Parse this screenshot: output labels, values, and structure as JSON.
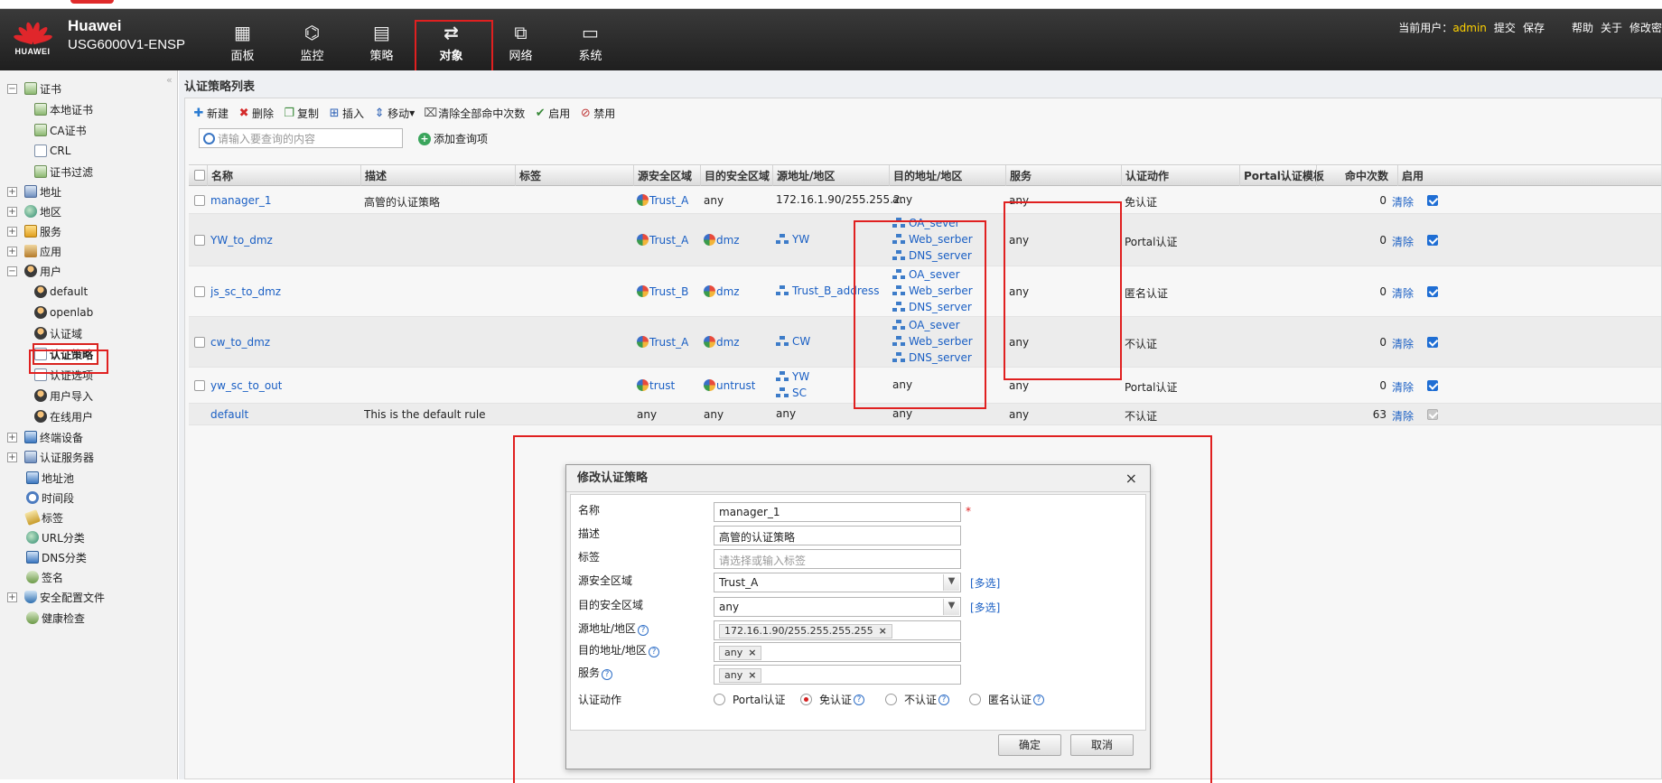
{
  "header": {
    "brand_logo_text": "HUAWEI",
    "brand_name": "Huawei",
    "model": "USG6000V1-ENSP",
    "nav": [
      {
        "label": "面板",
        "icon": "dashboard-icon"
      },
      {
        "label": "监控",
        "icon": "monitor-icon"
      },
      {
        "label": "策略",
        "icon": "policy-icon"
      },
      {
        "label": "对象",
        "icon": "object-icon"
      },
      {
        "label": "网络",
        "icon": "network-icon"
      },
      {
        "label": "系统",
        "icon": "system-icon"
      }
    ],
    "active_nav": "对象",
    "user_label": "当前用户：",
    "username": "admin",
    "menu": [
      "提交",
      "保存",
      "帮助",
      "关于",
      "修改密"
    ]
  },
  "sidebar": {
    "items": [
      {
        "label": "证书",
        "expander": "−",
        "icon": "certificate-icon"
      },
      {
        "label": "本地证书",
        "icon": "local-certificate-icon"
      },
      {
        "label": "CA证书",
        "icon": "ca-certificate-icon"
      },
      {
        "label": "CRL",
        "icon": "crl-icon"
      },
      {
        "label": "证书过滤",
        "icon": "certificate-filter-icon"
      },
      {
        "label": "地址",
        "expander": "+",
        "icon": "address-icon"
      },
      {
        "label": "地区",
        "expander": "+",
        "icon": "region-icon"
      },
      {
        "label": "服务",
        "expander": "+",
        "icon": "service-icon"
      },
      {
        "label": "应用",
        "expander": "+",
        "icon": "application-icon"
      },
      {
        "label": "用户",
        "expander": "−",
        "icon": "user-icon"
      },
      {
        "label": "default",
        "icon": "user-group-icon"
      },
      {
        "label": "openlab",
        "icon": "user-group-icon"
      },
      {
        "label": "认证域",
        "icon": "auth-domain-icon"
      },
      {
        "label": "认证策略",
        "icon": "auth-policy-icon",
        "selected": true
      },
      {
        "label": "认证选项",
        "icon": "auth-options-icon"
      },
      {
        "label": "用户导入",
        "icon": "user-import-icon"
      },
      {
        "label": "在线用户",
        "icon": "online-user-icon"
      },
      {
        "label": "终端设备",
        "expander": "+",
        "icon": "terminal-device-icon"
      },
      {
        "label": "认证服务器",
        "expander": "+",
        "icon": "auth-server-icon"
      },
      {
        "label": "地址池",
        "icon": "address-pool-icon"
      },
      {
        "label": "时间段",
        "icon": "time-range-icon"
      },
      {
        "label": "标签",
        "icon": "tag-icon"
      },
      {
        "label": "URL分类",
        "icon": "url-category-icon"
      },
      {
        "label": "DNS分类",
        "icon": "dns-category-icon"
      },
      {
        "label": "签名",
        "icon": "signature-icon"
      },
      {
        "label": "安全配置文件",
        "expander": "+",
        "icon": "security-profile-icon"
      },
      {
        "label": "健康检查",
        "icon": "health-check-icon"
      }
    ]
  },
  "panel": {
    "title": "认证策略列表",
    "toolbar": [
      {
        "label": "新建",
        "icon": "add-icon"
      },
      {
        "label": "删除",
        "icon": "delete-icon"
      },
      {
        "label": "复制",
        "icon": "copy-icon"
      },
      {
        "label": "插入",
        "icon": "insert-icon"
      },
      {
        "label": "移动",
        "icon": "move-icon",
        "dropdown": true
      },
      {
        "label": "清除全部命中次数",
        "icon": "clear-hits-icon"
      },
      {
        "label": "启用",
        "icon": "enable-icon"
      },
      {
        "label": "禁用",
        "icon": "disable-icon"
      }
    ],
    "search_placeholder": "请输入要查询的内容",
    "add_query_label": "添加查询项"
  },
  "table": {
    "columns": [
      "名称",
      "描述",
      "标签",
      "源安全区域",
      "目的安全区域",
      "源地址/地区",
      "目的地址/地区",
      "服务",
      "认证动作",
      "Portal认证模板",
      "命中次数",
      "启用"
    ],
    "clear_label": "清除",
    "rows": [
      {
        "name": "manager_1",
        "desc": "高管的认证策略",
        "tag": "",
        "src_zone": "Trust_A",
        "dst_zone": "any",
        "src_addr": [
          "172.16.1.90/255.255.2..."
        ],
        "dst_addr": [
          "any"
        ],
        "service": "any",
        "action": "免认证",
        "portal": "",
        "hits": "0",
        "enabled": true
      },
      {
        "name": "YW_to_dmz",
        "desc": "",
        "tag": "",
        "src_zone": "Trust_A",
        "dst_zone": "dmz",
        "src_addr": [
          "YW"
        ],
        "dst_addr": [
          "OA_sever",
          "Web_serber",
          "DNS_server"
        ],
        "service": "any",
        "action": "Portal认证",
        "portal": "",
        "hits": "0",
        "enabled": true
      },
      {
        "name": "js_sc_to_dmz",
        "desc": "",
        "tag": "",
        "src_zone": "Trust_B",
        "dst_zone": "dmz",
        "src_addr": [
          "Trust_B_address"
        ],
        "dst_addr": [
          "OA_sever",
          "Web_serber",
          "DNS_server"
        ],
        "service": "any",
        "action": "匿名认证",
        "portal": "",
        "hits": "0",
        "enabled": true
      },
      {
        "name": "cw_to_dmz",
        "desc": "",
        "tag": "",
        "src_zone": "Trust_A",
        "dst_zone": "dmz",
        "src_addr": [
          "CW"
        ],
        "dst_addr": [
          "OA_sever",
          "Web_serber",
          "DNS_server"
        ],
        "service": "any",
        "action": "不认证",
        "portal": "",
        "hits": "0",
        "enabled": true
      },
      {
        "name": "yw_sc_to_out",
        "desc": "",
        "tag": "",
        "src_zone": "trust",
        "dst_zone": "untrust",
        "src_addr": [
          "YW",
          "SC"
        ],
        "dst_addr": [
          "any"
        ],
        "service": "any",
        "action": "Portal认证",
        "portal": "",
        "hits": "0",
        "enabled": true
      },
      {
        "name": "default",
        "desc": "This is the default rule",
        "tag": "",
        "src_zone": "any",
        "dst_zone": "any",
        "src_addr": [
          "any"
        ],
        "dst_addr": [
          "any"
        ],
        "service": "any",
        "action": "不认证",
        "portal": "",
        "hits": "63",
        "enabled": true,
        "locked": true
      }
    ]
  },
  "dialog": {
    "title": "修改认证策略",
    "close": "×",
    "name_label": "名称",
    "name_value": "manager_1",
    "required_mark": "*",
    "desc_label": "描述",
    "desc_value": "高管的认证策略",
    "tag_label": "标签",
    "tag_placeholder": "请选择或输入标签",
    "src_zone_label": "源安全区域",
    "src_zone_value": "Trust_A",
    "dst_zone_label": "目的安全区域",
    "dst_zone_value": "any",
    "multi_select": "[多选]",
    "src_addr_label": "源地址/地区",
    "src_addr_chip": "172.16.1.90/255.255.255.255",
    "dst_addr_label": "目的地址/地区",
    "dst_addr_chip": "any",
    "service_label": "服务",
    "service_chip": "any",
    "action_label": "认证动作",
    "actions": [
      {
        "label": "Portal认证",
        "checked": false,
        "help": false
      },
      {
        "label": "免认证",
        "checked": true,
        "help": true
      },
      {
        "label": "不认证",
        "checked": false,
        "help": true
      },
      {
        "label": "匿名认证",
        "checked": false,
        "help": true
      }
    ],
    "ok": "确定",
    "cancel": "取消",
    "help_mark": "?",
    "chip_remove": "×"
  },
  "colors": {
    "accent_link": "#1a5fc4",
    "highlight_red": "#e02020",
    "header_bg": "#2a2a2a",
    "username": "#ffd200"
  }
}
